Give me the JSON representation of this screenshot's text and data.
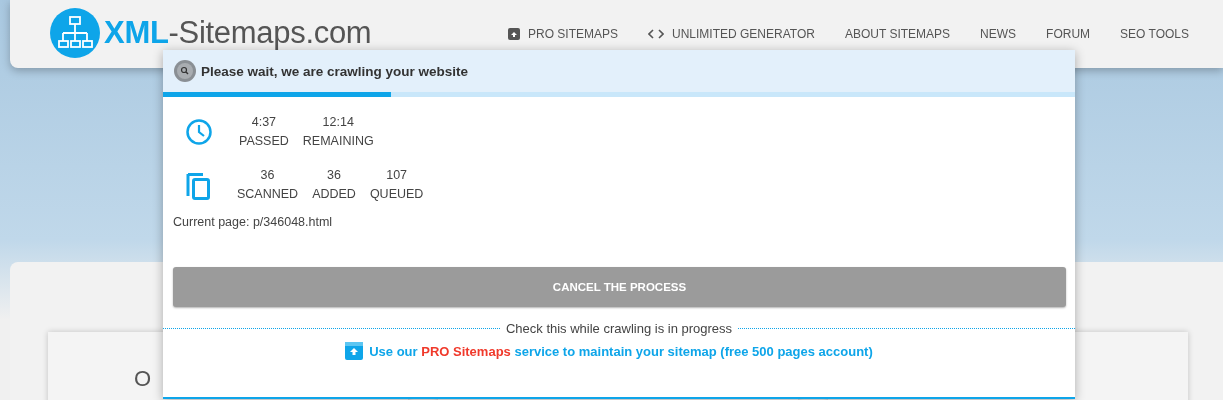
{
  "header": {
    "logo": {
      "bold": "XML",
      "rest": "-Sitemaps.com"
    },
    "nav": [
      {
        "label": "PRO SITEMAPS",
        "kind": "archive"
      },
      {
        "label": "UNLIMITED GENERATOR",
        "kind": "code"
      },
      {
        "label": "ABOUT SITEMAPS",
        "kind": "plain"
      },
      {
        "label": "NEWS",
        "kind": "plain"
      },
      {
        "label": "FORUM",
        "kind": "plain"
      },
      {
        "label": "SEO TOOLS",
        "kind": "plain"
      }
    ]
  },
  "background": {
    "heading": "O"
  },
  "dialog": {
    "title": "Please wait, we are crawling your website",
    "level": 0.25,
    "stat_groups": [
      {
        "kind": "time",
        "stats": [
          {
            "value": "4:37",
            "label": "PASSED"
          },
          {
            "value": "12:14",
            "label": "REMAINING"
          }
        ]
      },
      {
        "kind": "pages",
        "stats": [
          {
            "value": "36",
            "label": "SCANNED"
          },
          {
            "value": "36",
            "label": "ADDED"
          },
          {
            "value": "107",
            "label": "QUEUED"
          }
        ]
      }
    ],
    "current_page": "Current page: p/346048.html",
    "cancel_button": "CANCEL THE PROCESS",
    "divider_text": "Check this while crawling is in progress",
    "promo": {
      "before": "Use our ",
      "highlight": "PRO Sitemaps",
      "after": " service to maintain your sitemap (free 500 pages account)"
    }
  }
}
